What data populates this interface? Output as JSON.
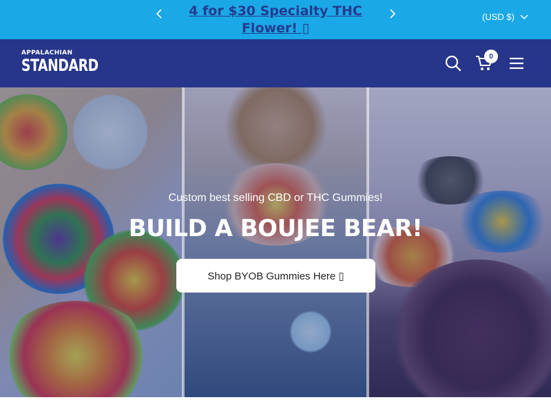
{
  "announcement": {
    "text": "4 for $30 Specialty THC Flower! ▯",
    "prev_icon": "chevron-left-icon",
    "next_icon": "chevron-right-icon"
  },
  "currency": {
    "label": "(USD $)",
    "icon": "chevron-down-icon"
  },
  "header": {
    "logo_top": "APPALACHIAN",
    "logo_bottom": "STANDARD",
    "search_icon": "search-icon",
    "cart_icon": "cart-icon",
    "cart_count": "0",
    "menu_icon": "hamburger-menu-icon"
  },
  "hero": {
    "subtitle": "Custom best selling CBD or THC Gummies!",
    "title": "BUILD A BOUJEE BEAR!",
    "button_label": "Shop BYOB Gummies Here ▯"
  },
  "colors": {
    "announcement_bg": "#1aa8e6",
    "announcement_text": "#233b8f",
    "header_bg": "#27358a",
    "button_bg": "#ffffff"
  }
}
